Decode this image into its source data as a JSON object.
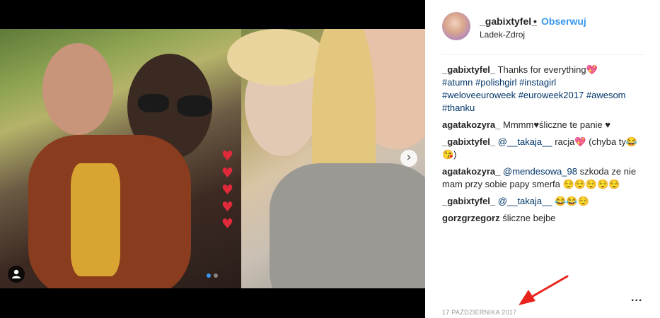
{
  "post": {
    "username": "_gabixtyfel_",
    "separator": "•",
    "follow_label": "Obserwuj",
    "location": "Ladek-Zdroj",
    "date": "17 PAŹDZIERNIKA 2017",
    "more_label": "..."
  },
  "media": {
    "hearts": [
      "♥",
      "♥",
      "♥",
      "♥",
      "♥"
    ],
    "next_icon": "›",
    "carousel_dots": 2,
    "active_dot": 0
  },
  "comments": [
    {
      "user": "_gabixtyfel_",
      "parts": [
        {
          "t": "text",
          "v": "Thanks for everything💖"
        },
        {
          "t": "br"
        },
        {
          "t": "tag",
          "v": "#atumn"
        },
        {
          "t": "text",
          "v": " "
        },
        {
          "t": "tag",
          "v": "#polishgirl"
        },
        {
          "t": "text",
          "v": " "
        },
        {
          "t": "tag",
          "v": "#instagirl"
        },
        {
          "t": "br"
        },
        {
          "t": "tag",
          "v": "#weloveeuroweek"
        },
        {
          "t": "text",
          "v": " "
        },
        {
          "t": "tag",
          "v": "#euroweek2017"
        },
        {
          "t": "text",
          "v": " "
        },
        {
          "t": "tag",
          "v": "#awesom"
        },
        {
          "t": "br"
        },
        {
          "t": "tag",
          "v": "#thanku"
        }
      ]
    },
    {
      "user": "agatakozyra_",
      "parts": [
        {
          "t": "text",
          "v": "Mmmm♥śliczne te panie ♥"
        }
      ]
    },
    {
      "user": "_gabixtyfel_",
      "parts": [
        {
          "t": "tag",
          "v": "@__takaja__"
        },
        {
          "t": "text",
          "v": " racja💖 (chyba ty😂😘)"
        }
      ]
    },
    {
      "user": "agatakozyra_",
      "parts": [
        {
          "t": "tag",
          "v": "@mendesowa_98"
        },
        {
          "t": "text",
          "v": " szkoda ze nie mam przy sobie papy smerfa 😌😌😌😌😌"
        }
      ]
    },
    {
      "user": "_gabixtyfel_",
      "parts": [
        {
          "t": "tag",
          "v": "@__takaja__"
        },
        {
          "t": "text",
          "v": " 😂😂😌"
        }
      ]
    },
    {
      "user": "gorzgrzegorz",
      "parts": [
        {
          "t": "text",
          "v": "śliczne bejbe"
        }
      ]
    }
  ],
  "colors": {
    "accent": "#3897f0",
    "hashtag": "#003569",
    "annotation_arrow": "#e8231c"
  }
}
